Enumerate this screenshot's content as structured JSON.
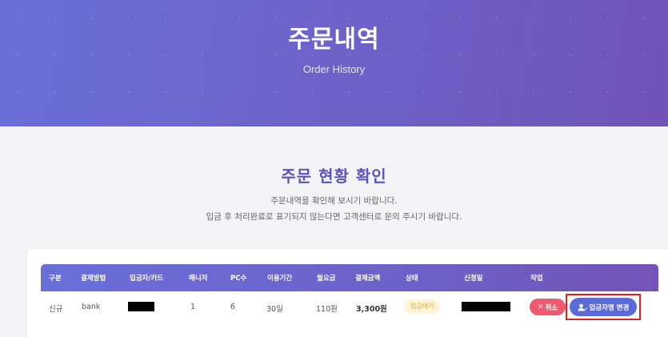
{
  "hero": {
    "title": "주문내역",
    "subtitle": "Order History"
  },
  "section": {
    "title": "주문 현황 확인",
    "desc1": "주문내역을 확인해 보시기 바랍니다.",
    "desc2": "입금 후 처리완료로 표기되지 않는다면 고객센터로 문의 주시기 바랍니다."
  },
  "table": {
    "headers": [
      "구분",
      "결제방법",
      "입금자/카드",
      "매니저",
      "PC수",
      "이용기간",
      "월요금",
      "결제금액",
      "상태",
      "신청일",
      "작업"
    ],
    "rows": [
      {
        "type": "신규",
        "method": "bank",
        "depositor": "",
        "manager": "1",
        "pc_count": "6",
        "period": "30일",
        "monthly": "110원",
        "amount": "3,300원",
        "status": "입금대기",
        "date": "",
        "cancel_label": "취소",
        "change_label": "입금자명 변경"
      }
    ]
  },
  "colors": {
    "accent": "#6a6fd8",
    "title": "#5a54c2",
    "cancel": "#ef5a6f",
    "change": "#5b6ad6",
    "status_pending": "#e8a200",
    "highlight": "#e02020"
  },
  "icons": {
    "cancel": "close-icon",
    "change": "user-edit-icon"
  }
}
